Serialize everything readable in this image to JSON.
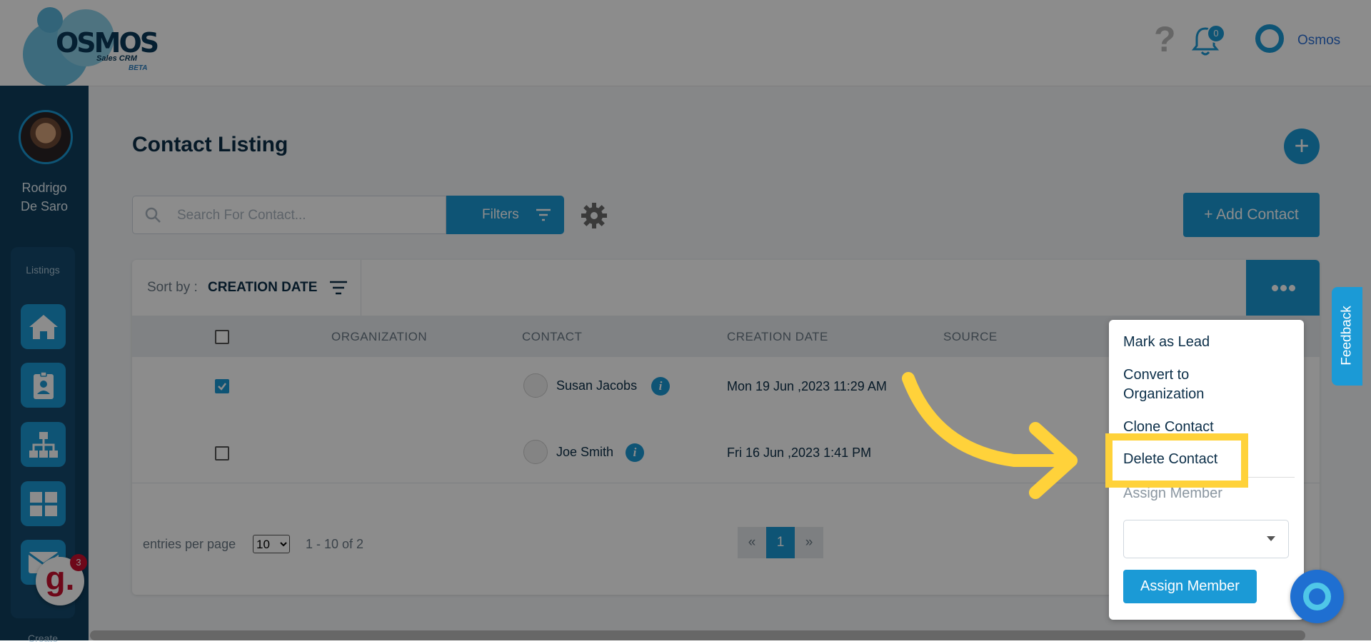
{
  "header": {
    "logo_text": "OSMOS",
    "logo_sub": "Sales CRM",
    "logo_beta": "BETA",
    "help_icon": "question-icon",
    "notification_count": "0",
    "user_name": "Osmos"
  },
  "sidebar": {
    "user_name_line1": "Rodrigo",
    "user_name_line2": "De Saro",
    "section_label": "Listings",
    "items": [
      "home-icon",
      "contact-card-icon",
      "org-chart-icon",
      "grid-icon",
      "mail-icon"
    ],
    "create_label": "Create",
    "g_badge_letter": "g.",
    "g_badge_count": "3"
  },
  "page": {
    "title": "Contact Listing",
    "search_placeholder": "Search For Contact...",
    "filters_label": "Filters",
    "add_contact_label": "+ Add Contact",
    "plus_label": "+"
  },
  "sort": {
    "label": "Sort by : ",
    "value": "CREATION DATE"
  },
  "table": {
    "columns": [
      "ORGANIZATION",
      "CONTACT",
      "CREATION DATE",
      "SOURCE"
    ],
    "rows": [
      {
        "organization": "",
        "contact": "Susan Jacobs",
        "creation_date": "Mon 19 Jun ,2023 11:29 AM",
        "source": "",
        "checked": true
      },
      {
        "organization": "",
        "contact": "Joe Smith",
        "creation_date": "Fri 16 Jun ,2023 1:41 PM",
        "source": "",
        "checked": false
      }
    ]
  },
  "pagination": {
    "entries_label": "entries per page",
    "per_page": "10",
    "range": "1 - 10 of 2",
    "prev": "«",
    "current": "1",
    "next": "»"
  },
  "menu": {
    "items": [
      "Mark as Lead",
      "Convert to Organization",
      "Clone Contact",
      "Delete Contact"
    ],
    "assign_label": "Assign Member",
    "assign_button": "Assign Member"
  },
  "feedback_label": "Feedback",
  "colors": {
    "accent": "#1b9ad6",
    "sidebar": "#0f3e5e",
    "highlight": "#ffd23a"
  }
}
